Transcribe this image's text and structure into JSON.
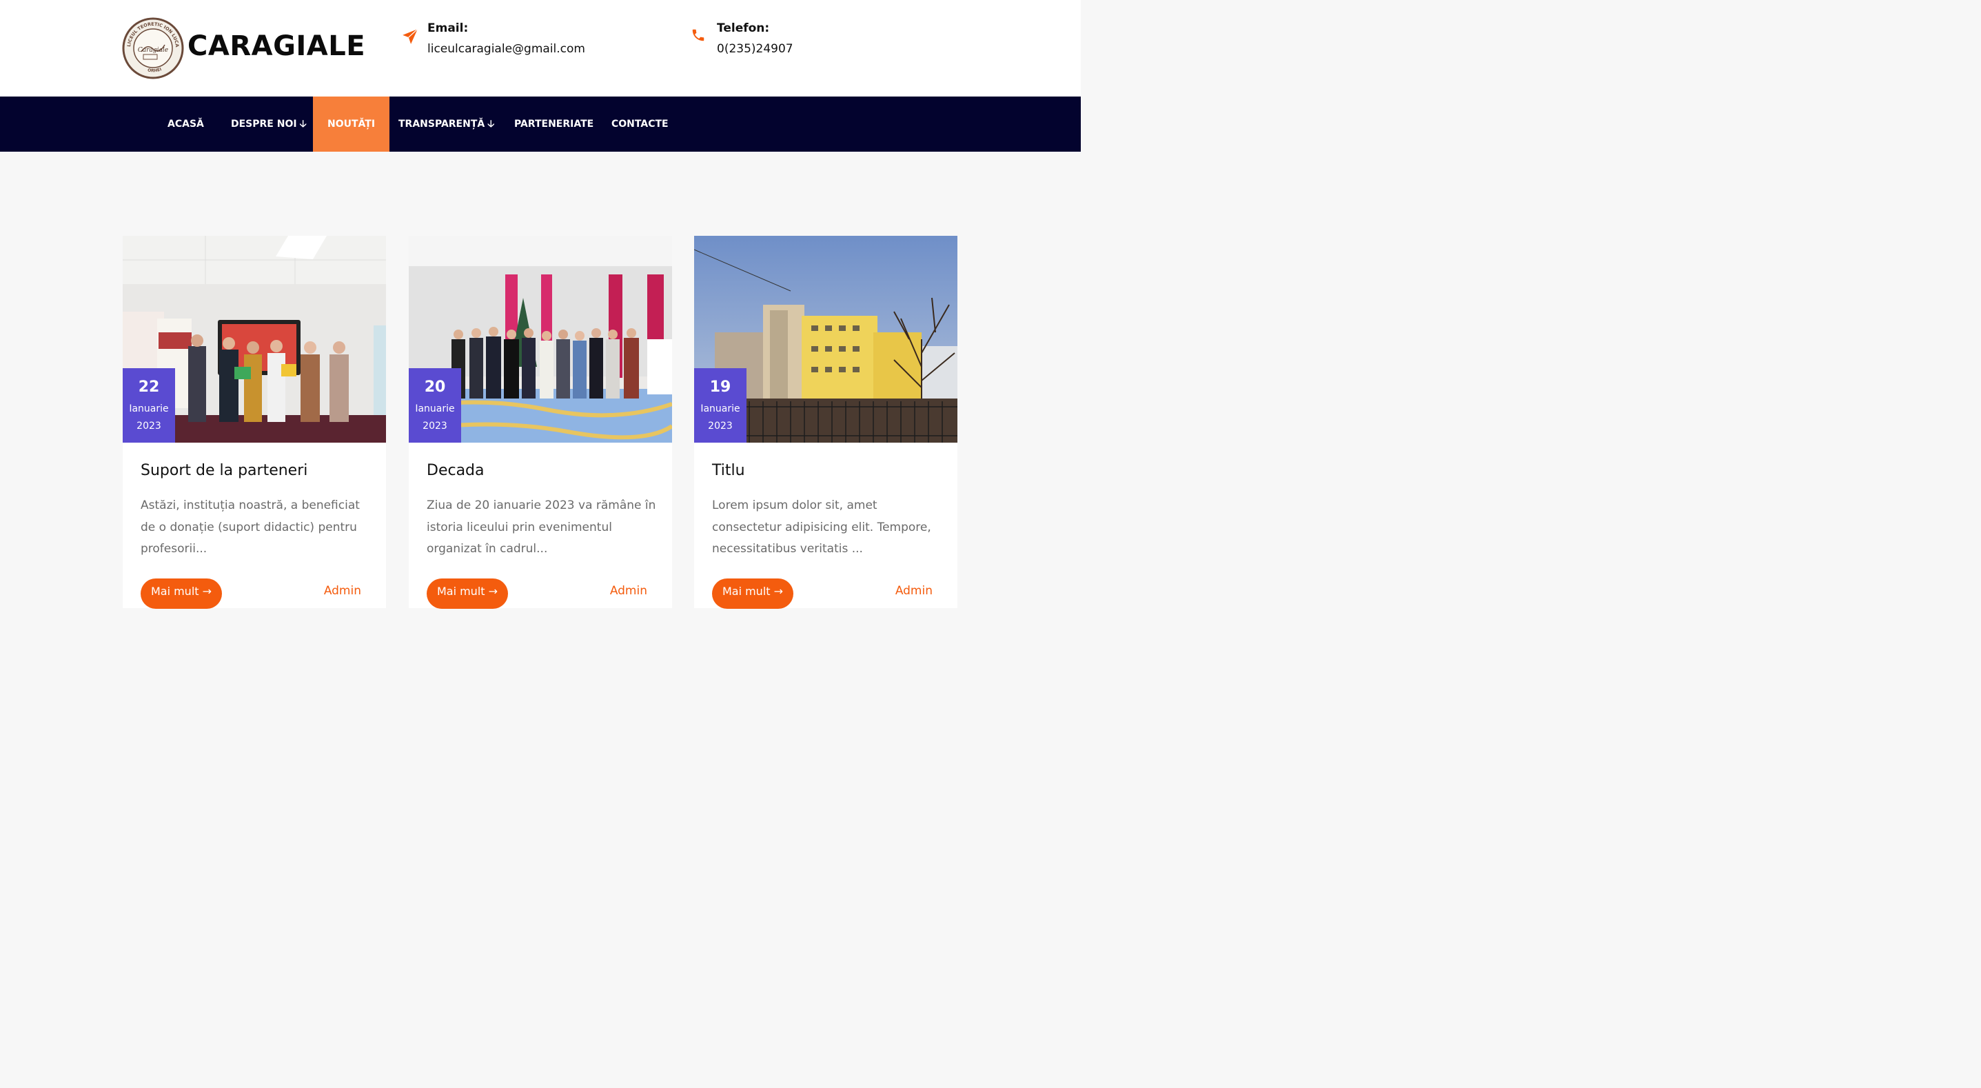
{
  "brand": {
    "name": "CARAGIALE",
    "logo_text_top": "LICEUL TEORETIC ION LUCA CARAGIALE",
    "logo_text_bottom": "ORHEI",
    "logo_script": "Caragiale"
  },
  "contact": {
    "email_label": "Email:",
    "email_value": "liceulcaragiale@gmail.com",
    "phone_label": "Telefon:",
    "phone_value": "0(235)24907",
    "email_icon": "paper-plane-icon",
    "phone_icon": "phone-icon"
  },
  "nav": {
    "items": [
      {
        "label": "ACASĂ",
        "dropdown": false,
        "active": false
      },
      {
        "label": "DESPRE NOI",
        "dropdown": true,
        "active": false
      },
      {
        "label": "NOUTĂȚI",
        "dropdown": false,
        "active": true
      },
      {
        "label": "TRANSPARENȚĂ",
        "dropdown": true,
        "active": false
      },
      {
        "label": "PARTENERIATE",
        "dropdown": false,
        "active": false
      },
      {
        "label": "CONTACTE",
        "dropdown": false,
        "active": false
      }
    ],
    "dropdown_arrow": "🡣"
  },
  "posts": [
    {
      "day": "22",
      "month": "Ianuarie",
      "year": "2023",
      "title": "Suport de la parteneri",
      "excerpt": "Astăzi, instituția noastră, a beneficiat de o donație (suport didactic) pentru profesorii...",
      "button": "Mai mult →",
      "author": "Admin"
    },
    {
      "day": "20",
      "month": "Ianuarie",
      "year": "2023",
      "title": "Decada",
      "excerpt": "Ziua de 20 ianuarie 2023 va rămâne în istoria liceului prin evenimentul organizat în cadrul...",
      "button": "Mai mult →",
      "author": "Admin"
    },
    {
      "day": "19",
      "month": "Ianuarie",
      "year": "2023",
      "title": "Titlu",
      "excerpt": "Lorem ipsum dolor sit, amet consectetur adipisicing elit. Tempore, necessitatibus veritatis ...",
      "button": "Mai mult →",
      "author": "Admin"
    }
  ],
  "colors": {
    "nav_bg": "#03032e",
    "nav_active": "#f77f3a",
    "accent": "#f45c0e",
    "badge": "#5a4bd1"
  }
}
